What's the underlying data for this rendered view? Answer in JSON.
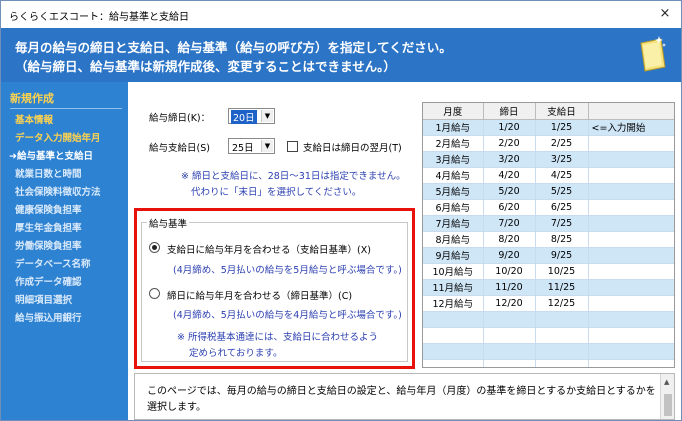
{
  "window": {
    "title": "らくらくエスコート：給与基準と支給日",
    "close_glyph": "×"
  },
  "banner": {
    "line1": "毎月の給与の締日と支給日、給与基準（給与の呼び方）を指定してください。",
    "line2": "（給与締日、給与基準は新規作成後、変更することはできません。）"
  },
  "sidebar": {
    "header": "新規作成",
    "items": [
      {
        "label": "基本情報"
      },
      {
        "label": "データ入力開始年月"
      },
      {
        "label": "➜給与基準と支給日"
      },
      {
        "label": "就業日数と時間"
      },
      {
        "label": "社会保険料徴収方法"
      },
      {
        "label": "健康保険負担率"
      },
      {
        "label": "厚生年金負担率"
      },
      {
        "label": "労働保険負担率"
      },
      {
        "label": "データベース名称"
      },
      {
        "label": "作成データ確認"
      },
      {
        "label": "明細項目選択"
      },
      {
        "label": "給与振込用銀行"
      }
    ]
  },
  "form": {
    "closing_day_label": "給与締日(K)：",
    "closing_day_value": "20日",
    "pay_day_label": "給与支給日(S)",
    "pay_day_value": "25日",
    "next_month_label": "支給日は締日の翌月(T)",
    "note_line1": "※ 締日と支給日に、28日〜31日は指定できません。",
    "note_line2": "代わりに「末日」を選択してください。"
  },
  "basis": {
    "title": "給与基準",
    "option1_label": "支給日に給与年月を合わせる（支給日基準）(X)",
    "option1_note": "(4月締め、5月払いの給与を5月給与と呼ぶ場合です。)",
    "option2_label": "締日に給与年月を合わせる（締日基準）(C)",
    "option2_note": "(4月締め、5月払いの給与を4月給与と呼ぶ場合です。)",
    "tax_note1": "※ 所得税基本通達には、支給日に合わせるよう",
    "tax_note2": "定められております。",
    "selected": "option1"
  },
  "schedule": {
    "headers": [
      "月度",
      "締日",
      "支給日",
      ""
    ],
    "rows": [
      [
        "1月給与",
        "1/20",
        "1/25",
        "<=入力開始"
      ],
      [
        "2月給与",
        "2/20",
        "2/25",
        ""
      ],
      [
        "3月給与",
        "3/20",
        "3/25",
        ""
      ],
      [
        "4月給与",
        "4/20",
        "4/25",
        ""
      ],
      [
        "5月給与",
        "5/20",
        "5/25",
        ""
      ],
      [
        "6月給与",
        "6/20",
        "6/25",
        ""
      ],
      [
        "7月給与",
        "7/20",
        "7/25",
        ""
      ],
      [
        "8月給与",
        "8/20",
        "8/25",
        ""
      ],
      [
        "9月給与",
        "9/20",
        "9/25",
        ""
      ],
      [
        "10月給与",
        "10/20",
        "10/25",
        ""
      ],
      [
        "11月給与",
        "11/20",
        "11/25",
        ""
      ],
      [
        "12月給与",
        "12/20",
        "12/25",
        ""
      ]
    ]
  },
  "description": {
    "text": "このページでは、毎月の給与の締日と支給日の設定と、給与年月（月度）の基準を締日とするか支給日とするかを選択します。"
  },
  "colors": {
    "banner": "#2b74c6",
    "sidebar": "#2e82d2",
    "highlight_border": "#e8120c",
    "row_alt": "#cfe6f7"
  }
}
